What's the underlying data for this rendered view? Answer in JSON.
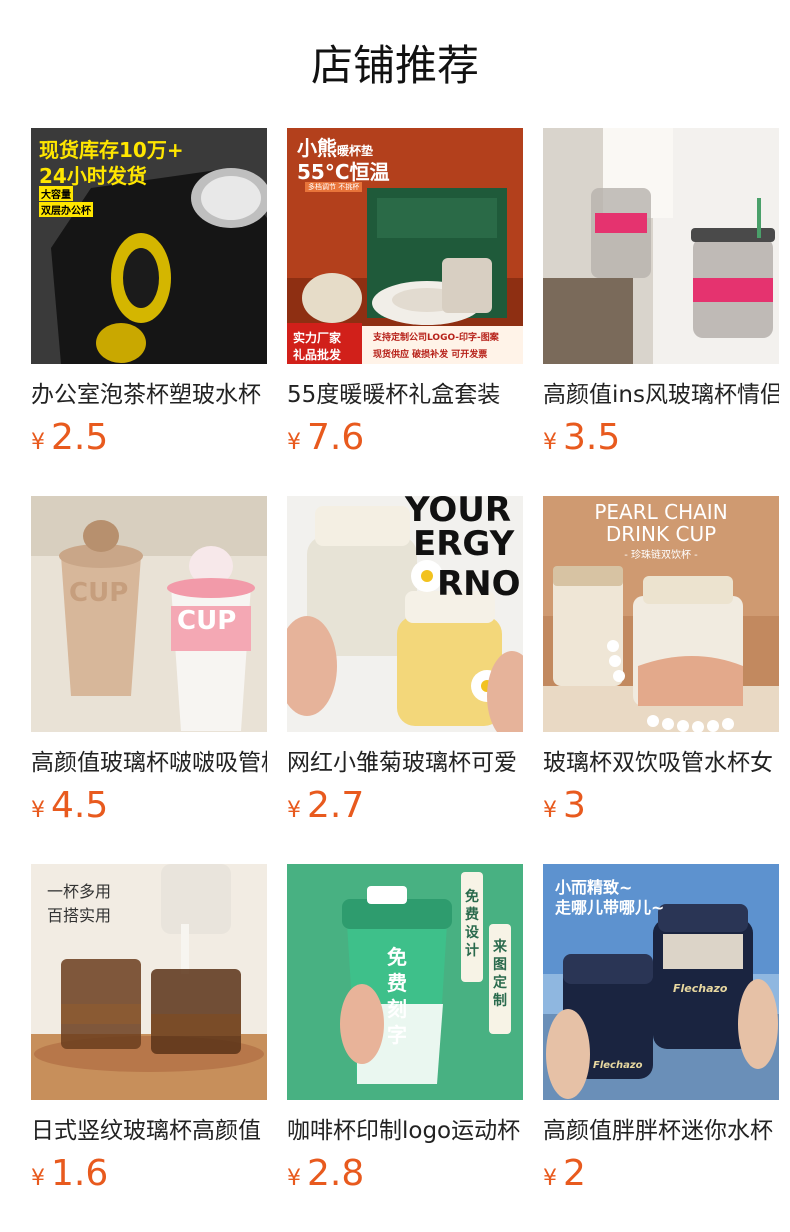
{
  "header": {
    "title": "店铺推荐"
  },
  "products": [
    {
      "name": "办公室泡茶杯塑玻水杯",
      "currency": "¥",
      "price": "2.5",
      "image": {
        "texts": [
          "现货库存10万+",
          "24小时发货",
          "大容量",
          "双层办公杯"
        ]
      }
    },
    {
      "name": "55度暖暖杯礼盒套装",
      "currency": "¥",
      "price": "7.6",
      "image": {
        "texts": [
          "小熊",
          "暖杯垫",
          "55°C恒温",
          "多档调节 不挑杯",
          "实力厂家",
          "礼品批发",
          "支持定制公司LOGO-印字-图案",
          "现货供应 破损补发 可开发票"
        ]
      }
    },
    {
      "name": "高颜值ins风玻璃杯情侣",
      "currency": "¥",
      "price": "3.5",
      "image": {
        "texts": []
      }
    },
    {
      "name": "高颜值玻璃杯啵啵吸管杯",
      "currency": "¥",
      "price": "4.5",
      "image": {
        "texts": [
          "CUP",
          "CUP"
        ]
      }
    },
    {
      "name": "网红小雏菊玻璃杯可爱",
      "currency": "¥",
      "price": "2.7",
      "image": {
        "texts": [
          "YOUR",
          "ERGY",
          "RNO"
        ]
      }
    },
    {
      "name": "玻璃杯双饮吸管水杯女",
      "currency": "¥",
      "price": "3",
      "image": {
        "texts": [
          "PEARL CHAIN",
          "DRINK CUP",
          "- 珍珠链双饮杯 -"
        ]
      }
    },
    {
      "name": "日式竖纹玻璃杯高颜值",
      "currency": "¥",
      "price": "1.6",
      "image": {
        "texts": [
          "一杯多用",
          "百搭实用"
        ]
      }
    },
    {
      "name": "咖啡杯印制logo运动杯",
      "currency": "¥",
      "price": "2.8",
      "image": {
        "texts": [
          "免费设计",
          "来图定制",
          "免费刻字"
        ]
      }
    },
    {
      "name": "高颜值胖胖杯迷你水杯",
      "currency": "¥",
      "price": "2",
      "image": {
        "texts": [
          "小而精致~",
          "走哪儿带哪儿~",
          "Flechazo",
          "Flechazo"
        ]
      }
    }
  ],
  "colors": {
    "price": "#e85a1e"
  }
}
